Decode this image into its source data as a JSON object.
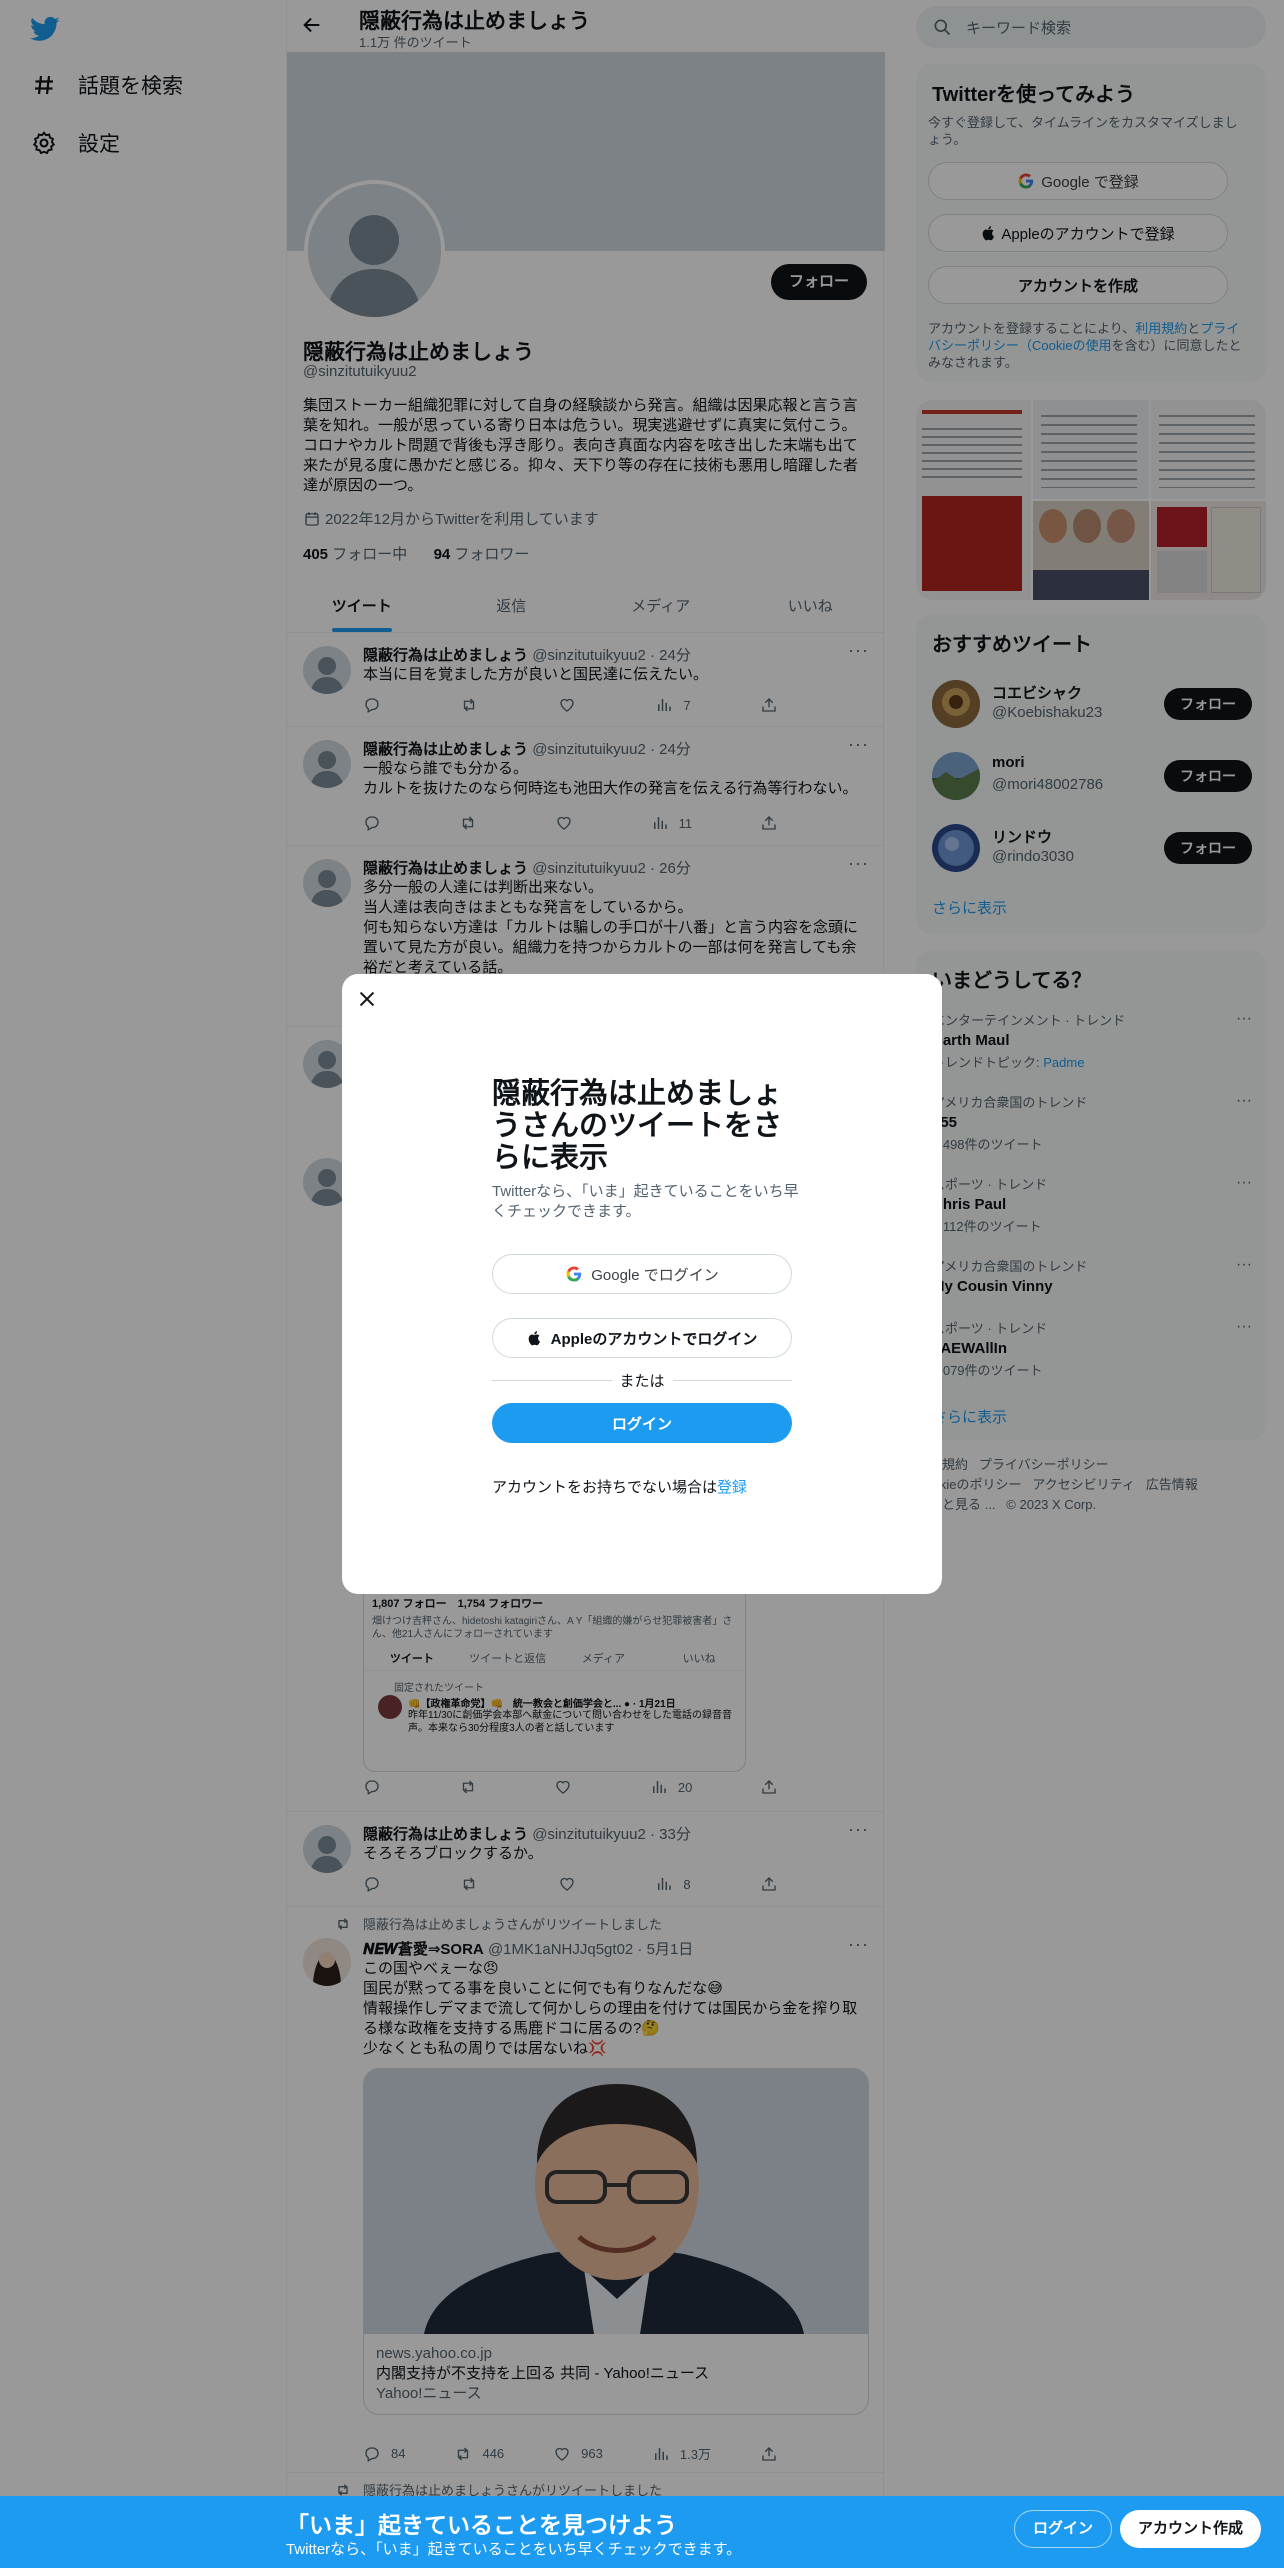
{
  "nav": {
    "explore_label": "話題を検索",
    "settings_label": "設定"
  },
  "header": {
    "title": "隠蔽行為は止めましょう",
    "tweet_count": "1.1万 件のツイート"
  },
  "profile": {
    "name": "隠蔽行為は止めましょう",
    "handle": "@sinzitutuikyuu2",
    "bio": "集団ストーカー組織犯罪に対して自身の経験談から発言。組織は因果応報と言う言葉を知れ。一般が思っている寄り日本は危うい。現実逃避せずに真実に気付こう。コロナやカルト問題で背後も浮き彫り。表向き真面な内容を呟き出した末端も出て来たが見る度に愚かだと感じる。抑々、天下り等の存在に技術も悪用し暗躍した者達が原因の一つ。",
    "joined": "2022年12月からTwitterを利用しています",
    "following_count": "405",
    "following_label": "フォロー中",
    "followers_count": "94",
    "followers_label": "フォロワー",
    "follow_button": "フォロー"
  },
  "tabs": [
    "ツイート",
    "返信",
    "メディア",
    "いいね"
  ],
  "tweets": [
    {
      "name": "隠蔽行為は止めましょう",
      "handle": "@sinzitutuikyuu2",
      "time": "24分",
      "text": "本当に目を覚ました方が良いと国民達に伝えたい。",
      "views": "7"
    },
    {
      "name": "隠蔽行為は止めましょう",
      "handle": "@sinzitutuikyuu2",
      "time": "24分",
      "text": "一般なら誰でも分かる。\nカルトを抜けたのなら何時迄も池田大作の発言を伝える行為等行わない。",
      "views": "11"
    },
    {
      "name": "隠蔽行為は止めましょう",
      "handle": "@sinzitutuikyuu2",
      "time": "26分",
      "text": "多分一般の人達には判断出来ない。\n当人達は表向きはまともな発言をしているから。\n何も知らない方達は「カルトは騙しの手口が十八番」と言う内容を念頭に置いて見た方が良い。組織力を持つからカルトの一部は何を発言しても余裕だと考えている話。"
    },
    {
      "embed_stats": "1,807 フォロー　1,754 フォロワー",
      "embed_followed_by": "畑けつけ吉秤さん、hidetoshi katagiriさん、A Y「組織的嫌がらせ犯罪被害者」さん、他21人さんにフォローされています",
      "embed_tabs": [
        "ツイート",
        "ツイートと返信",
        "メディア",
        "いいね"
      ],
      "embed_pinned": "固定されたツイート",
      "embed_pinned_title": "👊【政権革命党】👊　統一教会と創価学会と... ● · 1月21日",
      "embed_pinned_text": "昨年11/30に創価学会本部へ献金について問い合わせをした電話の録音音声。本来なら30分程度3人の者と話しています",
      "views": "20"
    },
    {
      "name": "隠蔽行為は止めましょう",
      "handle": "@sinzitutuikyuu2",
      "time": "33分",
      "text": "そろそろブロックするか。",
      "views": "8"
    },
    {
      "retweet_label": "隠蔽行為は止めましょうさんがリツイートしました",
      "name": "𝑵𝑬𝑾蒼愛⇒SORA",
      "handle": "@1MK1aNHJJq5gt02",
      "time": "5月1日",
      "text": "この国やべぇーな😠\n国民が黙ってる事を良いことに何でも有りなんだな😅\n情報操作しデマまで流して何かしらの理由を付けては国民から金を搾り取る様な政権を支持する馬鹿ドコに居るの?🤔\n少なくとも私の周りでは居ないね💢",
      "card_domain": "news.yahoo.co.jp",
      "card_title": "内閣支持が不支持を上回る 共同 - Yahoo!ニュース",
      "card_source": "Yahoo!ニュース",
      "replies": "84",
      "retweets": "446",
      "likes": "963",
      "views": "1.3万"
    },
    {
      "retweet_label": "隠蔽行為は止めましょうさんがリツイートしました"
    }
  ],
  "search": {
    "placeholder": "キーワード検索"
  },
  "signup_panel": {
    "title": "Twitterを使ってみよう",
    "subtitle": "今すぐ登録して、タイムラインをカスタマイズしましょう。",
    "google_button": "Google で登録",
    "apple_button": "Appleのアカウントで登録",
    "create_button": "アカウントを作成",
    "terms_pre": "アカウントを登録することにより、",
    "terms_link": "利用規約",
    "terms_mid": "と",
    "privacy_link": "プライバシーポリシー（Cookieの使用",
    "terms_post": "を含む）に同意したとみなされます。"
  },
  "suggested": {
    "title": "おすすめツイート",
    "follow_label": "フォロー",
    "users": [
      {
        "name": "コエビシャク",
        "handle": "@Koebishaku23"
      },
      {
        "name": "mori",
        "handle": "@mori48002786"
      },
      {
        "name": "リンドウ",
        "handle": "@rindo3030"
      }
    ],
    "show_more": "さらに表示"
  },
  "trends": {
    "title": "いまどうしてる？",
    "items": [
      {
        "category": "エンターテインメント · トレンド",
        "name": "Darth Maul",
        "extra_label": "トレンドトピック: ",
        "extra_link": "Padme"
      },
      {
        "category": "アメリカ合衆国のトレンド",
        "name": "155",
        "count": "3,498件のツイート"
      },
      {
        "category": "スポーツ · トレンド",
        "name": "Chris Paul",
        "count": "1,112件のツイート"
      },
      {
        "category": "アメリカ合衆国のトレンド",
        "name": "My Cousin Vinny"
      },
      {
        "category": "スポーツ · トレンド",
        "name": "#AEWAllIn",
        "count": "4,079件のツイート"
      }
    ],
    "show_more": "さらに表示"
  },
  "footer": {
    "terms": "利用規約",
    "privacy": "プライバシーポリシー",
    "cookie": "Cookieのポリシー",
    "accessibility": "アクセシビリティ",
    "ads": "広告情報",
    "more": "もっと見る ...",
    "copyright": "© 2023 X Corp."
  },
  "modal": {
    "title": "隠蔽行為は止めましょうさんのツイートをさらに表示",
    "subtitle": "Twitterなら、「いま」起きていることをいち早くチェックできます。",
    "google_button": "Google でログイン",
    "apple_button": "Appleのアカウントでログイン",
    "or": "または",
    "login_button": "ログイン",
    "signup_prompt": "アカウントをお持ちでない場合は",
    "signup_link": "登録"
  },
  "bottom_bar": {
    "title": "「いま」起きていることを見つけよう",
    "subtitle": "Twitterなら、「いま」起きていることをいち早くチェックできます。",
    "login_button": "ログイン",
    "signup_button": "アカウント作成"
  },
  "colors": {
    "brand_blue": "#1d9bf0",
    "text_primary": "#0f1419",
    "text_secondary": "#536471",
    "overlay": "rgba(0,0,0,0.4)"
  }
}
